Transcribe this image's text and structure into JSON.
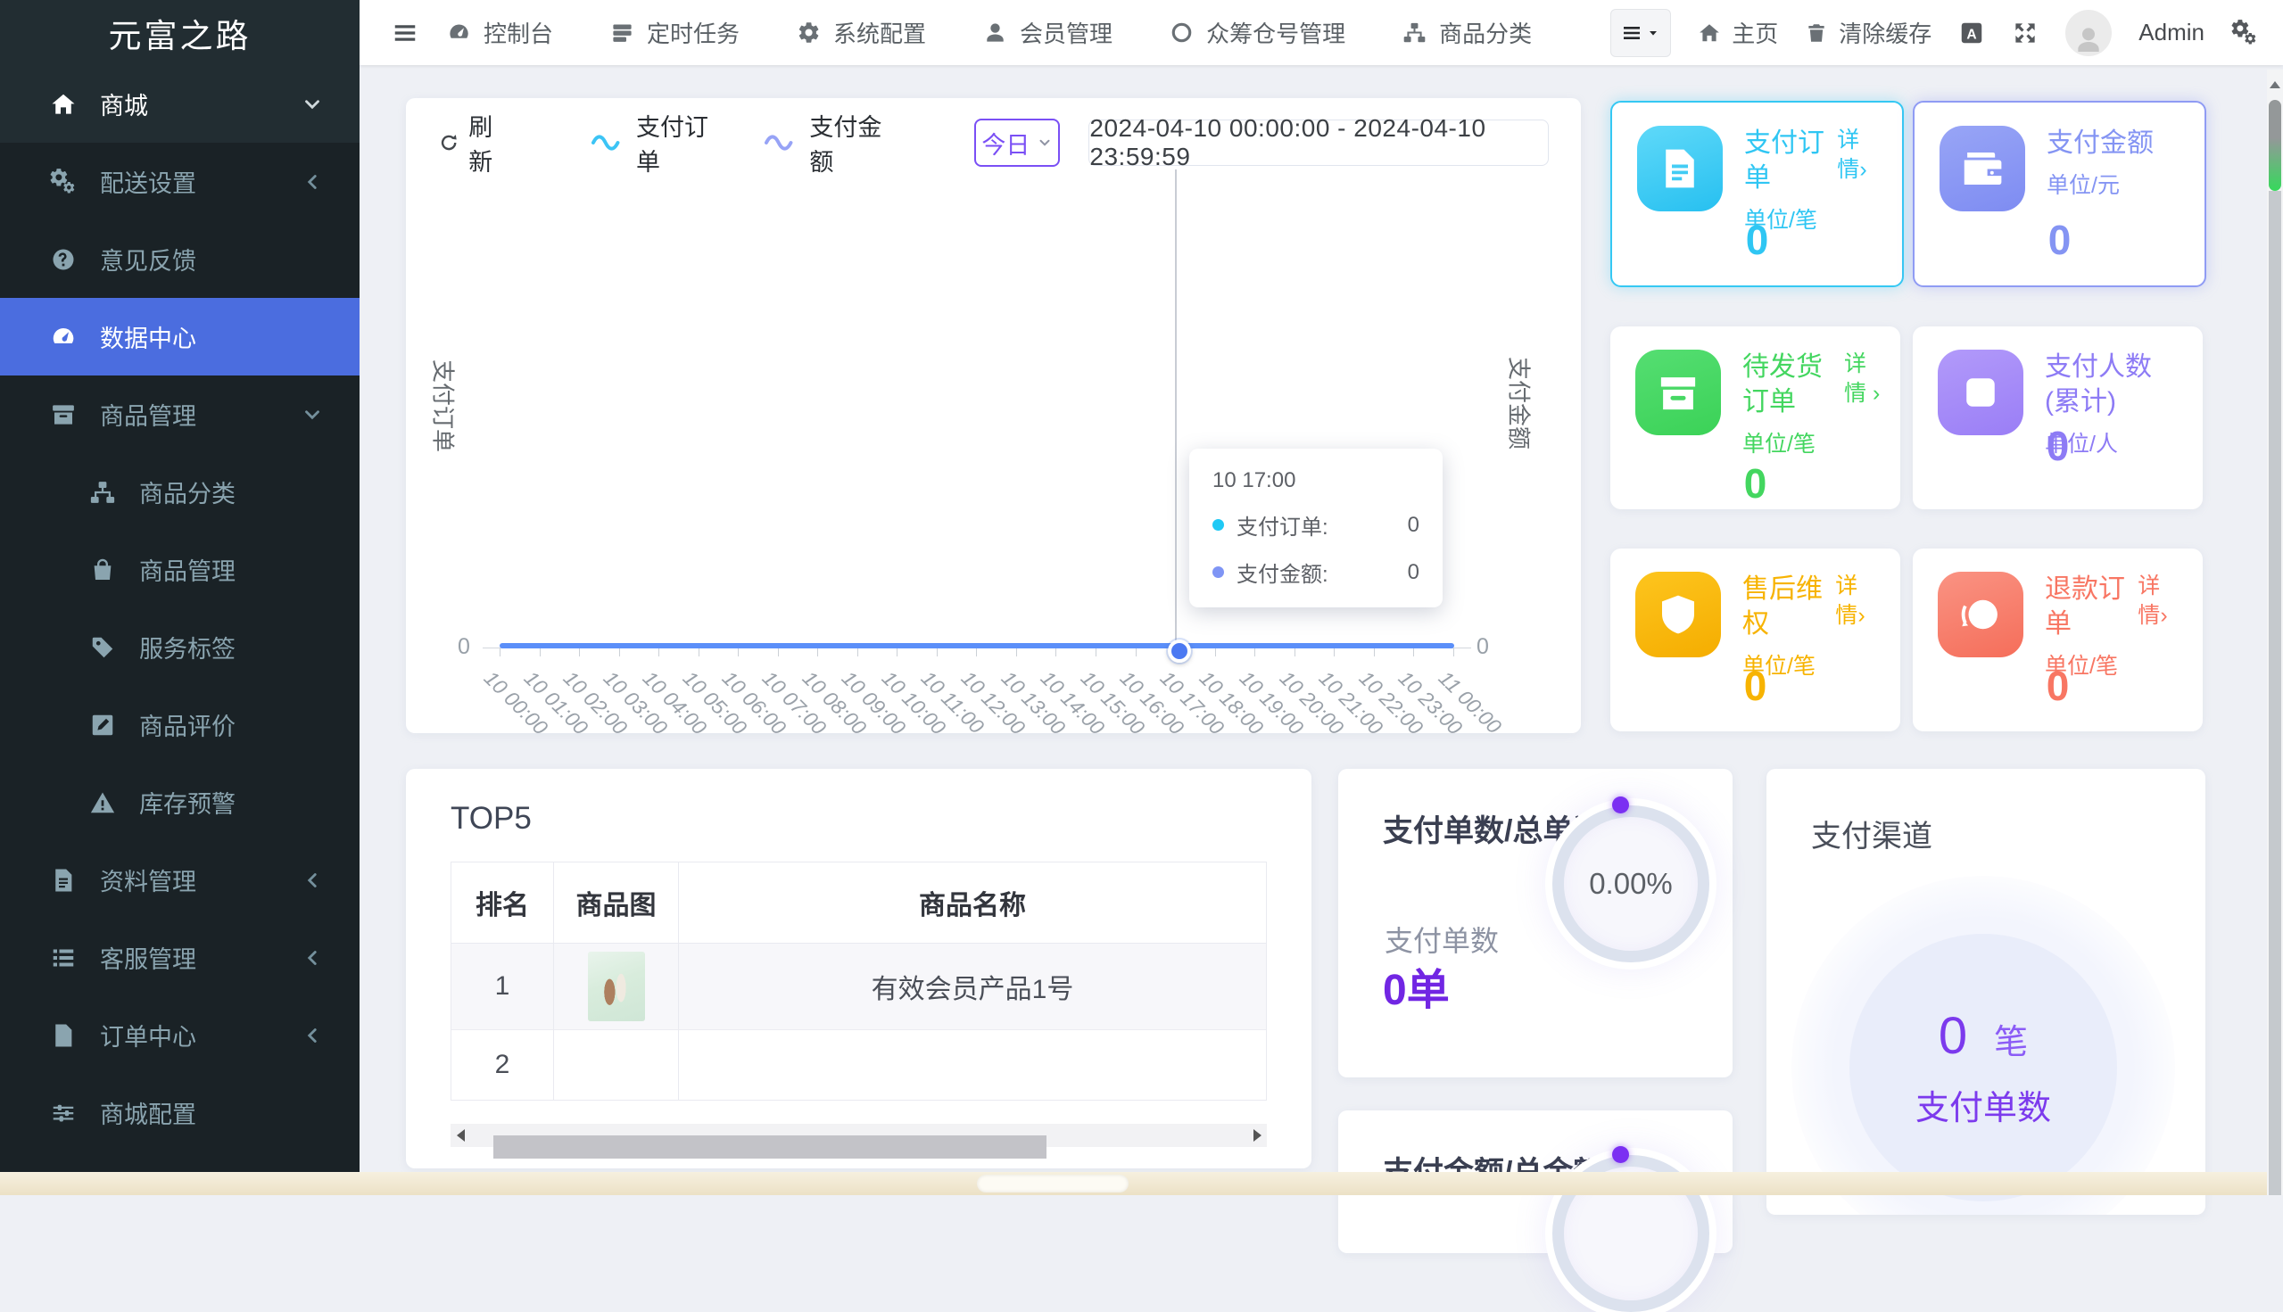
{
  "app": {
    "logo": "元富之路"
  },
  "colors": {
    "sidebar-active": "#4b6ddf",
    "cyan": "#2fc6f3",
    "periwinkle": "#8494f3",
    "green": "#43d65f",
    "purple": "#8d7bf5",
    "amber": "#f7b301",
    "salmon": "#f87663",
    "line-blue": "#5b8ff9",
    "gauge-dot": "#7b2ff2",
    "channel-purple": "#7c3aed",
    "legend1": "#3cc4f5",
    "legend2": "#97a3f6",
    "tt1": "#1fc9f5",
    "tt2": "#7f95f5"
  },
  "topbar": {
    "nav": [
      {
        "label": "控制台",
        "icon": "gauge-icon"
      },
      {
        "label": "定时任务",
        "icon": "server-icon"
      },
      {
        "label": "系统配置",
        "icon": "gear-icon"
      },
      {
        "label": "会员管理",
        "icon": "user-icon"
      },
      {
        "label": "众筹仓号管理",
        "icon": "circle-icon"
      },
      {
        "label": "商品分类",
        "icon": "sitemap-icon"
      }
    ],
    "home_label": "主页",
    "clear_cache_label": "清除缓存",
    "username": "Admin"
  },
  "sidebar": {
    "items": [
      {
        "label": "商城",
        "icon": "home-icon",
        "type": "header"
      },
      {
        "label": "配送设置",
        "icon": "gears-icon"
      },
      {
        "label": "意见反馈",
        "icon": "question-icon"
      },
      {
        "label": "数据中心",
        "icon": "gauge-icon",
        "active": true
      },
      {
        "label": "商品管理",
        "icon": "archive-icon"
      },
      {
        "label": "商品分类",
        "icon": "sitemap-icon",
        "sub": true
      },
      {
        "label": "商品管理",
        "icon": "bag-icon",
        "sub": true
      },
      {
        "label": "服务标签",
        "icon": "tag-icon",
        "sub": true
      },
      {
        "label": "商品评价",
        "icon": "edit-icon",
        "sub": true
      },
      {
        "label": "库存预警",
        "icon": "warning-icon",
        "sub": true
      },
      {
        "label": "资料管理",
        "icon": "file-text-icon"
      },
      {
        "label": "客服管理",
        "icon": "list-icon"
      },
      {
        "label": "订单中心",
        "icon": "file-icon"
      },
      {
        "label": "商城配置",
        "icon": "sliders-icon"
      }
    ]
  },
  "chart_panel": {
    "refresh_label": "刷新",
    "legend": [
      {
        "label": "支付订单",
        "color": "#3cc4f5"
      },
      {
        "label": "支付金额",
        "color": "#97a3f6"
      }
    ],
    "period_button": "今日",
    "date_range": "2024-04-10 00:00:00  -  2024-04-10 23:59:59",
    "tooltip": {
      "title": "10 17:00",
      "rows": [
        {
          "label": "支付订单:",
          "value": "0",
          "color": "#1fc9f5"
        },
        {
          "label": "支付金额:",
          "value": "0",
          "color": "#7f95f5"
        }
      ]
    }
  },
  "chart_data": {
    "type": "line",
    "x": [
      "10 00:00",
      "10 01:00",
      "10 02:00",
      "10 03:00",
      "10 04:00",
      "10 05:00",
      "10 06:00",
      "10 07:00",
      "10 08:00",
      "10 09:00",
      "10 10:00",
      "10 11:00",
      "10 12:00",
      "10 13:00",
      "10 14:00",
      "10 15:00",
      "10 16:00",
      "10 17:00",
      "10 18:00",
      "10 19:00",
      "10 20:00",
      "10 21:00",
      "10 22:00",
      "10 23:00",
      "11 00:00"
    ],
    "series": [
      {
        "name": "支付订单",
        "color": "#5b8ff9",
        "values": [
          0,
          0,
          0,
          0,
          0,
          0,
          0,
          0,
          0,
          0,
          0,
          0,
          0,
          0,
          0,
          0,
          0,
          0,
          0,
          0,
          0,
          0,
          0,
          0,
          0
        ]
      },
      {
        "name": "支付金额",
        "color": "#5b8ff9",
        "values": [
          0,
          0,
          0,
          0,
          0,
          0,
          0,
          0,
          0,
          0,
          0,
          0,
          0,
          0,
          0,
          0,
          0,
          0,
          0,
          0,
          0,
          0,
          0,
          0,
          0
        ]
      }
    ],
    "ylabel_left": "支付订单",
    "ylabel_right": "支付金额",
    "y_tick_left": "0",
    "y_tick_right": "0",
    "ylim": [
      0,
      1
    ],
    "highlight_x": "10 17:00",
    "grid": false,
    "legend_position": "top"
  },
  "stat_cards": [
    {
      "title": "支付订单",
      "detail": "详情",
      "unit": "单位/笔",
      "value": "0",
      "color": "#2fc6f3"
    },
    {
      "title": "支付金额",
      "detail": "",
      "unit": "单位/元",
      "value": "0",
      "color": "#8494f3"
    },
    {
      "title": "待发货订单",
      "detail": "详情",
      "unit": "单位/笔",
      "value": "0",
      "color": "#43d65f"
    },
    {
      "title": "支付人数(累计)",
      "detail": "",
      "unit": "单位/人",
      "value": "0",
      "color": "#8d7bf5"
    },
    {
      "title": "售后维权",
      "detail": "详情",
      "unit": "单位/笔",
      "value": "0",
      "color": "#f7b301"
    },
    {
      "title": "退款订单",
      "detail": "详情",
      "unit": "单位/笔",
      "value": "0",
      "color": "#f87663"
    }
  ],
  "misc": {
    "arrow": "›"
  },
  "top5": {
    "title": "TOP5",
    "headers": [
      "排名",
      "商品图",
      "商品名称"
    ],
    "rows": [
      {
        "rank": "1",
        "name": "有效会员产品1号",
        "has_image": true
      },
      {
        "rank": "2",
        "name": "",
        "has_image": false
      }
    ]
  },
  "gauges": [
    {
      "title": "支付单数/总单数",
      "percent": "0.00%",
      "label": "支付单数",
      "value": "0单"
    },
    {
      "title": "支付金额/总金额"
    }
  ],
  "channel": {
    "title": "支付渠道",
    "value": "0",
    "unit": "笔",
    "label": "支付单数"
  }
}
